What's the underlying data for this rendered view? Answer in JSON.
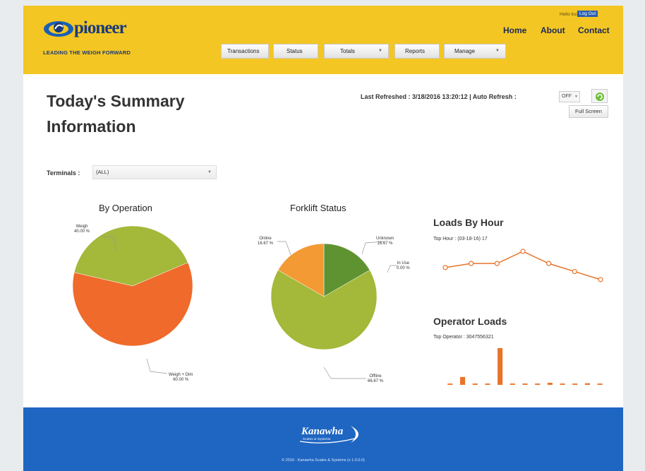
{
  "header": {
    "logo_word": "pioneer",
    "logo_tagline": "LEADING THE WEIGH FORWARD",
    "greeting": "Hello kss",
    "logout_label": "Log Out",
    "nav": [
      "Home",
      "About",
      "Contact"
    ],
    "menu": [
      {
        "label": "Transactions",
        "has_dropdown": false
      },
      {
        "label": "Status",
        "has_dropdown": false
      },
      {
        "label": "Totals",
        "has_dropdown": true
      },
      {
        "label": "Reports",
        "has_dropdown": false
      },
      {
        "label": "Manage",
        "has_dropdown": true
      }
    ]
  },
  "page": {
    "title": "Today's Summary Information",
    "last_refreshed": "Last Refreshed : 3/18/2016 13:20:12 | Auto Refresh :",
    "auto_refresh_value": "OFF",
    "refresh_icon": "refresh-icon",
    "fullscreen_label": "Full Screen",
    "terminals_label": "Terminals :",
    "terminals_value": "(ALL)"
  },
  "colors": {
    "brand_yellow": "#f3c623",
    "footer_blue": "#1f66c2",
    "pie_green": "#a4b83a",
    "pie_orange": "#ef6a2b",
    "pie_light_orange": "#f39a34",
    "pie_dark_green": "#5f9231",
    "line_orange": "#e8742a"
  },
  "chart_data": [
    {
      "type": "pie",
      "title": "By Operation",
      "slices": [
        {
          "name": "Weigh",
          "value": 40.0,
          "label": "40.00 %"
        },
        {
          "name": "Weigh + Dim",
          "value": 60.0,
          "label": "60.00 %"
        }
      ]
    },
    {
      "type": "pie",
      "title": "Forklift Status",
      "slices": [
        {
          "name": "Unknown",
          "value": 16.67,
          "label": "16.67 %"
        },
        {
          "name": "In Use",
          "value": 0.0,
          "label": "0.00 %"
        },
        {
          "name": "Offline",
          "value": 66.67,
          "label": "66.67 %"
        },
        {
          "name": "Online",
          "value": 16.67,
          "label": "16.67 %"
        }
      ]
    },
    {
      "type": "line",
      "title": "Loads By Hour",
      "subtitle": "Top Hour : (03-18-16) 17",
      "values": [
        5,
        6,
        6,
        9,
        6,
        4,
        2
      ]
    },
    {
      "type": "bar",
      "title": "Operator Loads",
      "subtitle": "Top Operator : 3047556321",
      "values": [
        0.5,
        3,
        0.5,
        0.5,
        14,
        0.5,
        0.5,
        0.5,
        0.8,
        0.5,
        0.5,
        0.6,
        0.5
      ]
    }
  ],
  "footer": {
    "logo_word": "Kanawha",
    "logo_sub": "Scales & Systems",
    "copyright": "© 2016 - Kanawha Scales & Systems (v 1.0.0.0)"
  }
}
